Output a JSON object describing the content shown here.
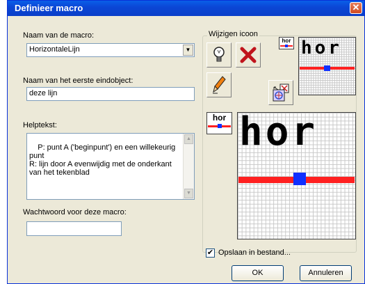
{
  "window": {
    "title": "Definieer macro",
    "close_label": "✕"
  },
  "macro_name": {
    "label": "Naam van de macro:",
    "value": "HorizontaleLijn"
  },
  "end_object": {
    "label": "Naam van het eerste eindobject:",
    "value": "deze lijn"
  },
  "help": {
    "label": "Helptekst:",
    "value": "P: punt A ('beginpunt') en een willekeurig punt\nR: lijn door A evenwijdig met de onderkant van het tekenblad"
  },
  "password": {
    "label": "Wachtwoord voor deze macro:",
    "value": ""
  },
  "icon_group": {
    "title": "Wijzigen icoon",
    "small_icon_text": "hor",
    "large_icon_text": "hor"
  },
  "icons": {
    "bulb": "lightbulb-icon",
    "delete": "red-x-icon",
    "pen": "pen-icon",
    "import": "import-image-icon"
  },
  "save": {
    "label": "Opslaan in bestand...",
    "checked": true,
    "check_mark": "✔"
  },
  "buttons": {
    "ok": "OK",
    "cancel": "Annuleren"
  },
  "colors": {
    "titlebar": "#0a5fe8",
    "red_line": "#ff2020",
    "blue_mark": "#1030ff"
  }
}
